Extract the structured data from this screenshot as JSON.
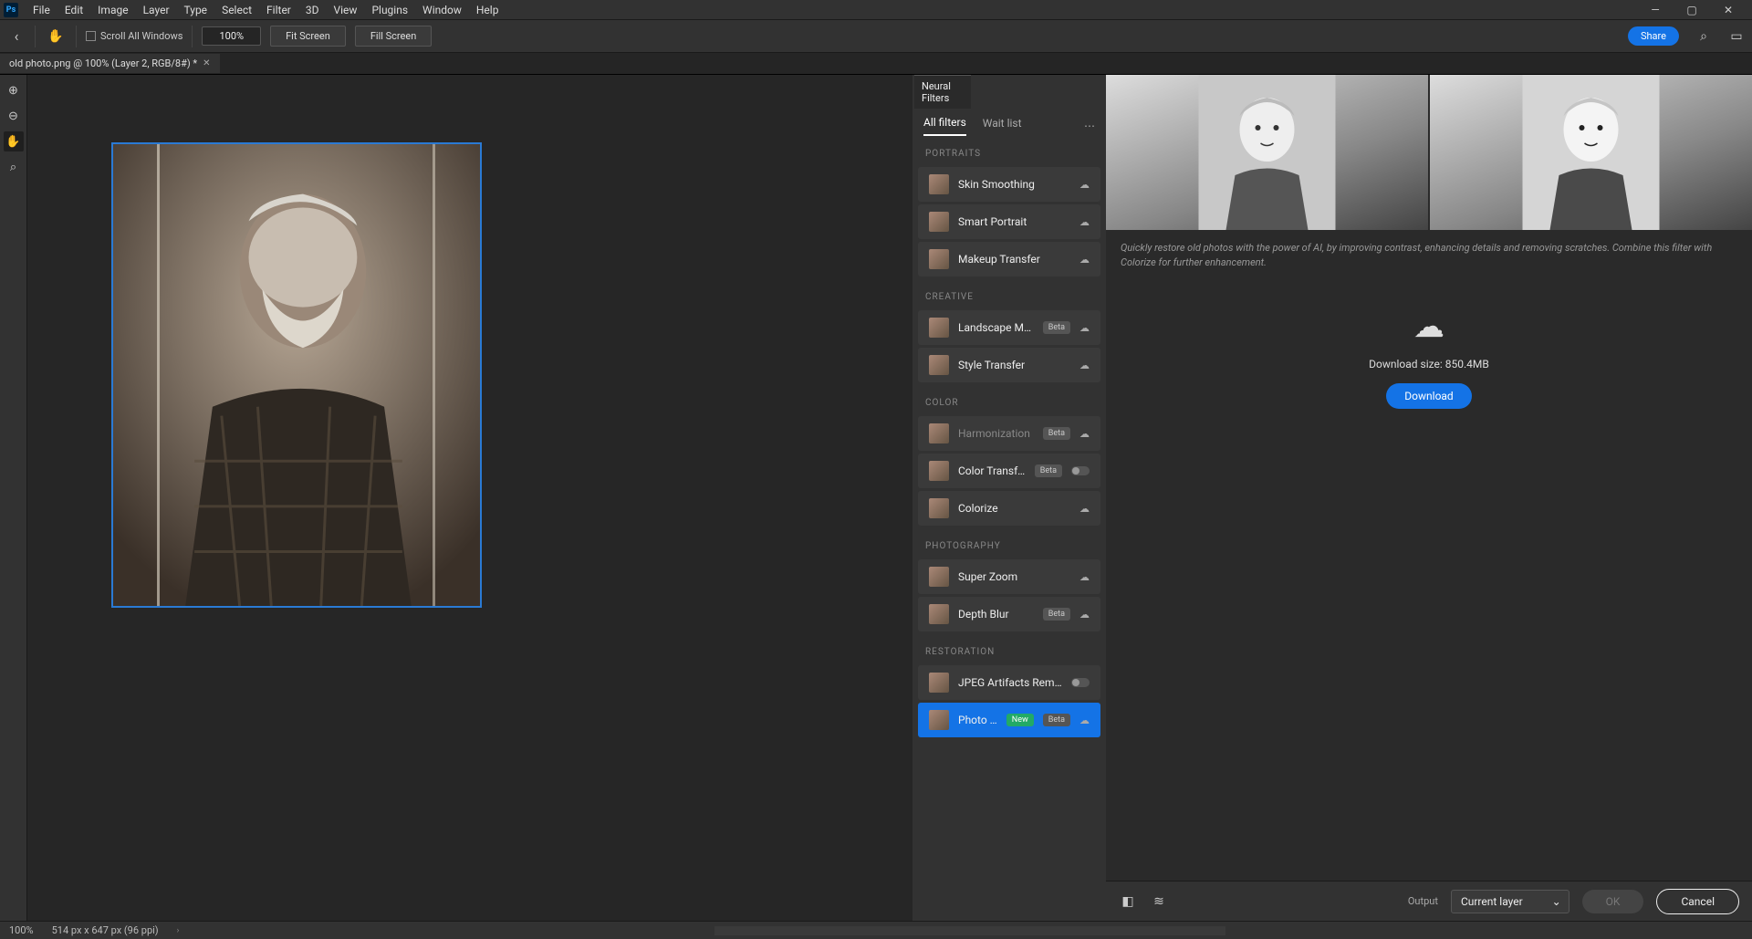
{
  "menu": [
    "File",
    "Edit",
    "Image",
    "Layer",
    "Type",
    "Select",
    "Filter",
    "3D",
    "View",
    "Plugins",
    "Window",
    "Help"
  ],
  "opt": {
    "scrollAll": "Scroll All Windows",
    "zoom": "100%",
    "fit": "Fit Screen",
    "fill": "Fill Screen",
    "share": "Share"
  },
  "tab": {
    "title": "old photo.png @ 100% (Layer 2, RGB/8#) *"
  },
  "nf": {
    "panel": "Neural Filters",
    "subtabs": {
      "all": "All filters",
      "wait": "Wait list"
    },
    "sections": {
      "portraits": "PORTRAITS",
      "creative": "CREATIVE",
      "color": "COLOR",
      "photography": "PHOTOGRAPHY",
      "restoration": "RESTORATION"
    },
    "items": {
      "skin": "Skin Smoothing",
      "smart": "Smart Portrait",
      "makeup": "Makeup Transfer",
      "landscape": "Landscape Mixer",
      "style": "Style Transfer",
      "harmon": "Harmonization",
      "colortrans": "Color Transfer",
      "colorize": "Colorize",
      "superzoom": "Super Zoom",
      "depth": "Depth Blur",
      "jpeg": "JPEG Artifacts Removal",
      "photores": "Photo Res…"
    },
    "badges": {
      "beta": "Beta",
      "new": "New"
    }
  },
  "detail": {
    "desc": "Quickly restore old photos with the power of AI, by improving contrast, enhancing details and removing scratches. Combine this filter with Colorize for further enhancement.",
    "size": "Download size: 850.4MB",
    "download": "Download"
  },
  "bottom": {
    "output": "Output",
    "sel": "Current layer",
    "ok": "OK",
    "cancel": "Cancel"
  },
  "status": {
    "zoom": "100%",
    "dim": "514 px x 647 px (96 ppi)"
  }
}
